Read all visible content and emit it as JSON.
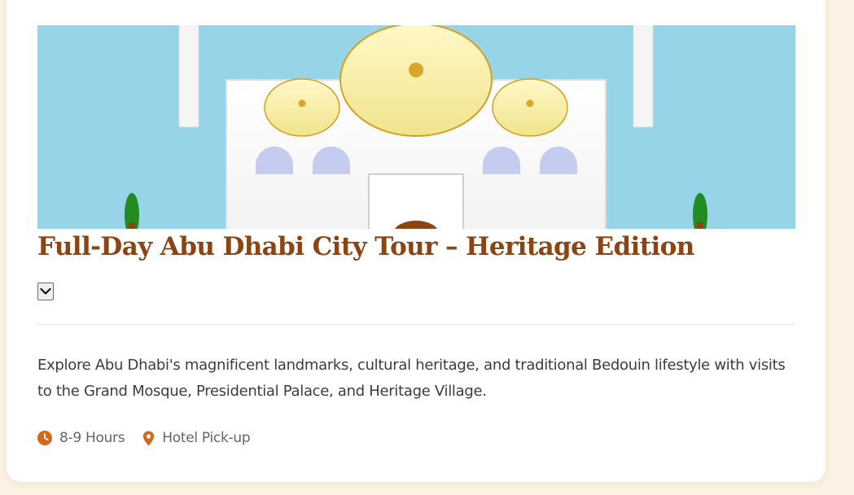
{
  "card": {
    "title": "Full-Day Abu Dhabi City Tour – Heritage Edition",
    "toggle_icon": "chevron-down-icon",
    "description": "Explore Abu Dhabi's magnificent landmarks, cultural heritage, and traditional Bedouin lifestyle with visits to the Grand Mosque, Presidential Palace, and Heritage Village.",
    "meta": {
      "duration_icon": "clock-icon",
      "duration": "8-9 Hours",
      "pickup_icon": "map-pin-icon",
      "pickup": "Hotel Pick-up"
    }
  },
  "colors": {
    "page_background": "#fdf3e4",
    "title": "#8b4513",
    "accent": "#d2691e",
    "sky": "#97d4e8",
    "dome": "#f6eda0",
    "dome_outline": "#d4a020",
    "arch_window": "#c4cdf0",
    "tree": "#228b22"
  }
}
